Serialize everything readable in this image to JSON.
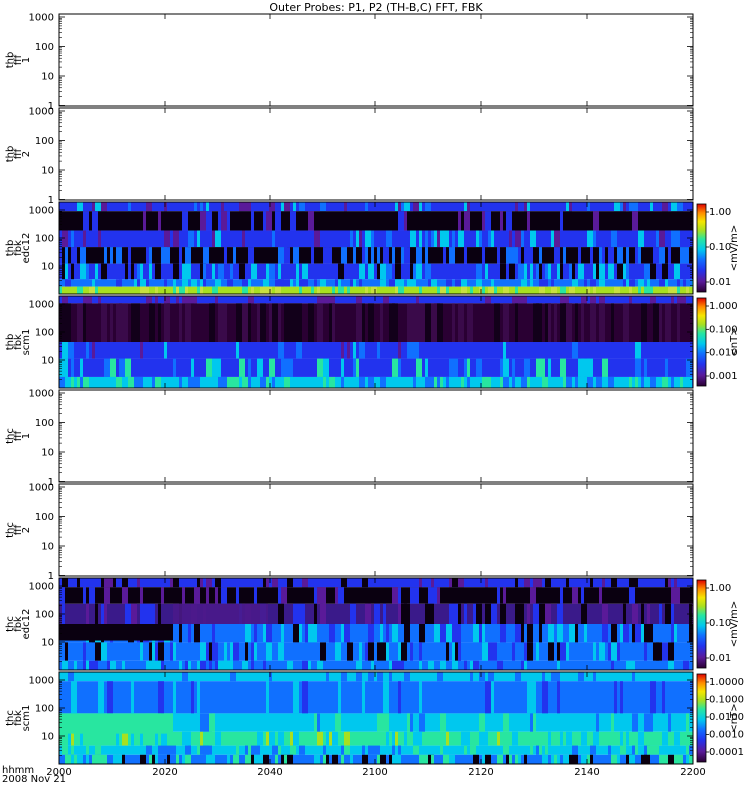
{
  "chart_data": {
    "type": "heatmap",
    "title": "Outer Probes: P1, P2 (TH-B,C) FFT, FBK",
    "x": {
      "ticks": [
        "2000",
        "2020",
        "2040",
        "2100",
        "2120",
        "2140",
        "2200"
      ],
      "label_line1": "hhmm",
      "label_line2": "2008 Nov 21"
    },
    "panels": [
      {
        "id": "thb-fff1",
        "label": [
          "thb",
          "fff",
          "1"
        ],
        "kind": "empty",
        "yticks": [
          "1000",
          "100",
          "10",
          "1"
        ]
      },
      {
        "id": "thb-fff2",
        "label": [
          "thb",
          "fff",
          "2"
        ],
        "kind": "empty",
        "yticks": [
          "1000",
          "100",
          "10",
          "1"
        ]
      },
      {
        "id": "thb-fbk-edc12",
        "label": [
          "thb",
          "fbk",
          "edc12"
        ],
        "kind": "spectrogram",
        "yticks": [
          "1000",
          "100",
          "10"
        ],
        "colorbar": {
          "unit": "<mV/m>",
          "ticks": [
            "1.00",
            "0.10",
            "0.01"
          ]
        }
      },
      {
        "id": "thb-fbk-scm1",
        "label": [
          "thb",
          "fbk",
          "scm1"
        ],
        "kind": "spectrogram",
        "yticks": [
          "1000",
          "100",
          "10"
        ],
        "colorbar": {
          "unit": "<nT>",
          "ticks": [
            "1.000",
            "0.100",
            "0.010",
            "0.001"
          ]
        }
      },
      {
        "id": "thc-fff1",
        "label": [
          "thc",
          "fff",
          "1"
        ],
        "kind": "empty",
        "yticks": [
          "1000",
          "100",
          "10",
          "1"
        ]
      },
      {
        "id": "thc-fff2",
        "label": [
          "thc",
          "fff",
          "2"
        ],
        "kind": "empty",
        "yticks": [
          "1000",
          "100",
          "10",
          "1"
        ]
      },
      {
        "id": "thc-fbk-edc12",
        "label": [
          "thc",
          "fbk",
          "edc12"
        ],
        "kind": "spectrogram",
        "yticks": [
          "1000",
          "100",
          "10"
        ],
        "colorbar": {
          "unit": "<mV/m>",
          "ticks": [
            "1.00",
            "0.10",
            "0.01"
          ]
        }
      },
      {
        "id": "thc-fbk-scm1",
        "label": [
          "thc",
          "fbk",
          "scm1"
        ],
        "kind": "spectrogram",
        "yticks": [
          "1000",
          "100",
          "10"
        ],
        "colorbar": {
          "unit": "<nT>",
          "ticks": [
            "1.0000",
            "0.1000",
            "0.0100",
            "0.0010",
            "0.0001"
          ]
        }
      }
    ],
    "colormap": [
      "#2a0033",
      "#5a1a99",
      "#2233ee",
      "#1070ff",
      "#00c8ee",
      "#28e6a0",
      "#a8e020",
      "#f5e600",
      "#ff8c00",
      "#e00000"
    ]
  }
}
